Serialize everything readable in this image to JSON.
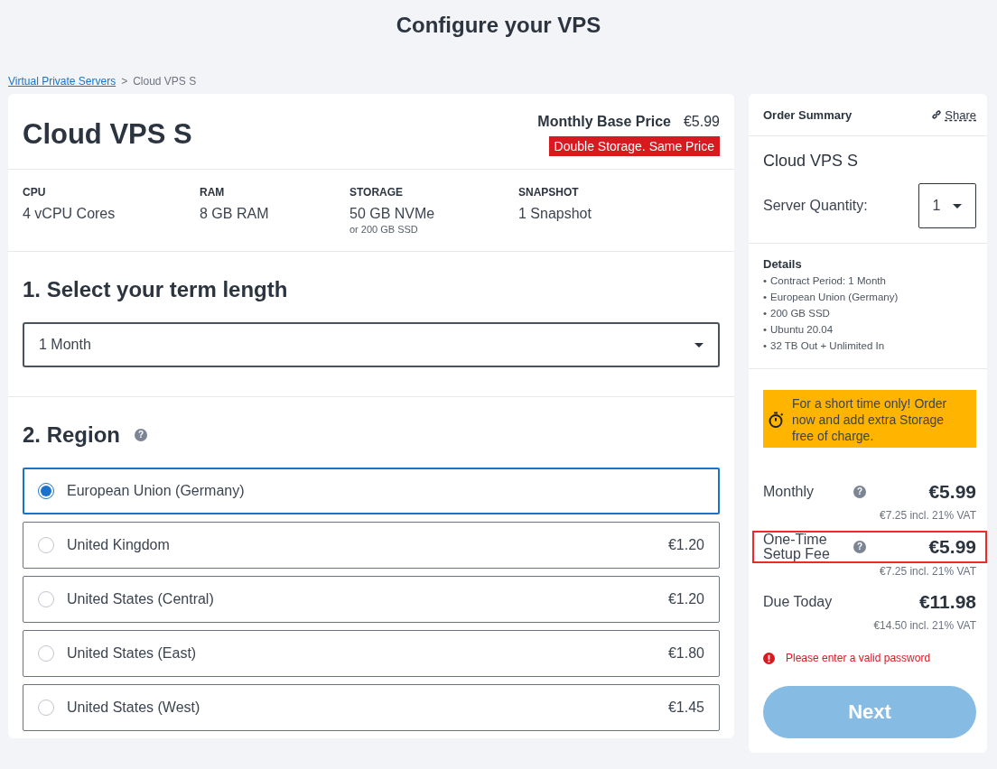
{
  "page_title": "Configure your VPS",
  "breadcrumb": {
    "link": "Virtual Private Servers",
    "separator": ">",
    "current": "Cloud VPS S"
  },
  "product": {
    "name": "Cloud VPS S",
    "base_price_label": "Monthly Base Price",
    "base_price": "€5.99",
    "promo_badge": "Double Storage. Same Price"
  },
  "specs": [
    {
      "label": "CPU",
      "value": "4 vCPU Cores"
    },
    {
      "label": "RAM",
      "value": "8 GB RAM"
    },
    {
      "label": "STORAGE",
      "value": "50 GB NVMe",
      "note": "or 200 GB SSD"
    },
    {
      "label": "SNAPSHOT",
      "value": "1 Snapshot"
    }
  ],
  "term": {
    "heading": "1. Select your term length",
    "value": "1 Month"
  },
  "region": {
    "heading": "2. Region",
    "help": "?",
    "options": [
      {
        "name": "European Union (Germany)",
        "selected": true
      },
      {
        "name": "United Kingdom",
        "price": "€1.20",
        "selected": false
      },
      {
        "name": "United States (Central)",
        "price": "€1.20",
        "selected": false
      },
      {
        "name": "United States (East)",
        "price": "€1.80",
        "selected": false
      },
      {
        "name": "United States (West)",
        "price": "€1.45",
        "selected": false
      }
    ]
  },
  "summary": {
    "title": "Order Summary",
    "share": "Share",
    "product": "Cloud VPS S",
    "quantity_label": "Server Quantity:",
    "quantity": "1",
    "details_heading": "Details",
    "details": [
      {
        "bullet": "•",
        "text": "Contract Period: 1 Month"
      },
      {
        "bullet": "•",
        "text": "European Union (Germany)"
      },
      {
        "bullet": "•",
        "text": "200 GB SSD"
      },
      {
        "bullet": "•",
        "text": "Ubuntu 20.04"
      },
      {
        "bullet": "•",
        "text": "32 TB Out + Unlimited In"
      }
    ],
    "promo": "For a short time only! Order now and add extra Storage free of charge.",
    "prices": [
      {
        "label": "Monthly",
        "help": "?",
        "price": "€5.99",
        "vat": "€7.25 incl. 21% VAT",
        "highlighted": false
      },
      {
        "label": "One-Time Setup Fee",
        "help": "?",
        "price": "€5.99",
        "vat": "€7.25 incl. 21% VAT",
        "highlighted": true
      },
      {
        "label": "Due Today",
        "price": "€11.98",
        "vat": "€14.50 incl. 21% VAT",
        "highlighted": false
      }
    ],
    "error": "Please enter a valid password",
    "next": {
      "label": "Next",
      "disabled": true
    }
  }
}
